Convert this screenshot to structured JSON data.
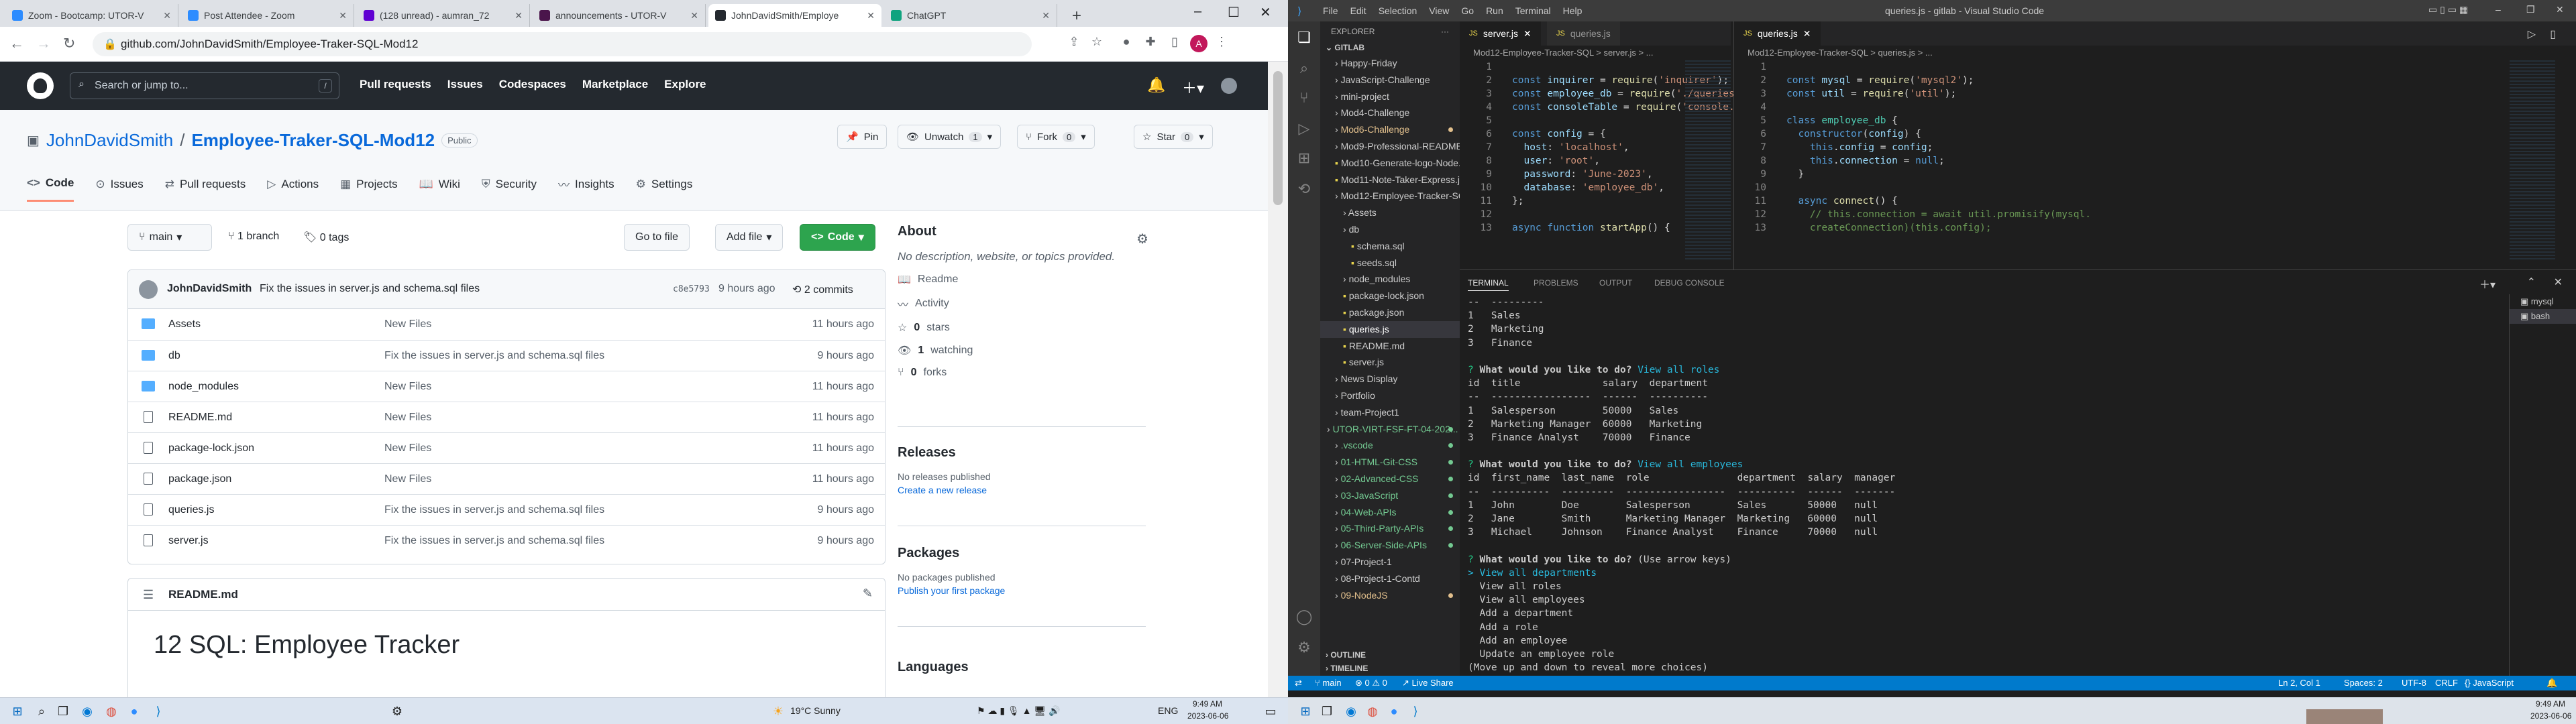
{
  "browser": {
    "tabs": [
      {
        "label": "Zoom - Bootcamp: UTOR-V",
        "color": "#2d8cff",
        "active": false
      },
      {
        "label": "Post Attendee - Zoom",
        "color": "#2d8cff",
        "active": false
      },
      {
        "label": "(128 unread) - aumran_72",
        "color": "#6001d2",
        "active": false
      },
      {
        "label": "announcements - UTOR-V",
        "color": "#4a154b",
        "active": false
      },
      {
        "label": "JohnDavidSmith/Employe",
        "color": "#24292f",
        "active": true
      },
      {
        "label": "ChatGPT",
        "color": "#10a37f",
        "active": false
      }
    ],
    "url": "github.com/JohnDavidSmith/Employee-Traker-SQL-Mod12"
  },
  "github": {
    "search_placeholder": "Search or jump to...",
    "search_key": "/",
    "nav": [
      "Pull requests",
      "Issues",
      "Codespaces",
      "Marketplace",
      "Explore"
    ],
    "owner": "JohnDavidSmith",
    "separator": "/",
    "repo": "Employee-Traker-SQL-Mod12",
    "visibility": "Public",
    "actions": {
      "pin": "Pin",
      "unwatch": "Unwatch",
      "watch_count": "1",
      "fork": "Fork",
      "fork_count": "0",
      "star": "Star",
      "star_count": "0"
    },
    "tabs": [
      "Code",
      "Issues",
      "Pull requests",
      "Actions",
      "Projects",
      "Wiki",
      "Security",
      "Insights",
      "Settings"
    ],
    "branch": "main",
    "branches": "1 branch",
    "tags": "0 tags",
    "buttons": {
      "goto": "Go to file",
      "add": "Add file",
      "code": "Code"
    },
    "commit": {
      "author": "JohnDavidSmith",
      "message": "Fix the issues in server.js and schema.sql files",
      "sha": "c8e5793",
      "ago": "9 hours ago",
      "count": "2 commits"
    },
    "files": [
      {
        "name": "Assets",
        "type": "folder",
        "msg": "New Files",
        "time": "11 hours ago"
      },
      {
        "name": "db",
        "type": "folder",
        "msg": "Fix the issues in server.js and schema.sql files",
        "time": "9 hours ago"
      },
      {
        "name": "node_modules",
        "type": "folder",
        "msg": "New Files",
        "time": "11 hours ago"
      },
      {
        "name": "README.md",
        "type": "file",
        "msg": "New Files",
        "time": "11 hours ago"
      },
      {
        "name": "package-lock.json",
        "type": "file",
        "msg": "New Files",
        "time": "11 hours ago"
      },
      {
        "name": "package.json",
        "type": "file",
        "msg": "New Files",
        "time": "11 hours ago"
      },
      {
        "name": "queries.js",
        "type": "file",
        "msg": "Fix the issues in server.js and schema.sql files",
        "time": "9 hours ago"
      },
      {
        "name": "server.js",
        "type": "file",
        "msg": "Fix the issues in server.js and schema.sql files",
        "time": "9 hours ago"
      }
    ],
    "readme_label": "README.md",
    "readme_title": "12 SQL: Employee Tracker",
    "about": {
      "title": "About",
      "desc": "No description, website, or topics provided.",
      "readme": "Readme",
      "activity": "Activity",
      "stars": "0",
      "stars_label": "stars",
      "watching": "1",
      "watching_label": "watching",
      "forks": "0",
      "forks_label": "forks"
    },
    "releases": {
      "title": "Releases",
      "none": "No releases published",
      "link": "Create a new release"
    },
    "packages": {
      "title": "Packages",
      "none": "No packages published",
      "link": "Publish your first package"
    },
    "languages": {
      "title": "Languages"
    }
  },
  "taskbar_left": {
    "weather": "19°C  Sunny",
    "lang": "ENG",
    "time": "9:49 AM",
    "date": "2023-06-06"
  },
  "vscode": {
    "menu": [
      "File",
      "Edit",
      "Selection",
      "View",
      "Go",
      "Run",
      "Terminal",
      "Help"
    ],
    "window_title": "queries.js - gitlab - Visual Studio Code",
    "explorer_title": "EXPLORER",
    "root": "GITLAB",
    "tree": [
      {
        "label": "Happy-Friday",
        "indent": 1,
        "color": "#cccccc",
        "dot": false
      },
      {
        "label": "JavaScript-Challenge",
        "indent": 1,
        "color": "#cccccc",
        "dot": false
      },
      {
        "label": "mini-project",
        "indent": 1,
        "color": "#cccccc",
        "dot": false
      },
      {
        "label": "Mod4-Challenge",
        "indent": 1,
        "color": "#cccccc",
        "dot": false
      },
      {
        "label": "Mod6-Challenge",
        "indent": 1,
        "color": "#e2c08d",
        "dot": true
      },
      {
        "label": "Mod9-Professional-README-Ge...",
        "indent": 1,
        "color": "#cccccc",
        "dot": false
      },
      {
        "label": "Mod10-Generate-logo-Node.js",
        "indent": 1,
        "color": "#cccccc",
        "dot": false
      },
      {
        "label": "Mod11-Note-Taker-Express.js",
        "indent": 1,
        "color": "#cccccc",
        "dot": false
      },
      {
        "label": "Mod12-Employee-Tracker-SQL",
        "indent": 1,
        "color": "#cccccc",
        "dot": false
      },
      {
        "label": "Assets",
        "indent": 2,
        "color": "#cccccc",
        "dot": false
      },
      {
        "label": "db",
        "indent": 2,
        "color": "#cccccc",
        "dot": false
      },
      {
        "label": "schema.sql",
        "indent": 3,
        "color": "#cccccc",
        "dot": false
      },
      {
        "label": "seeds.sql",
        "indent": 3,
        "color": "#cccccc",
        "dot": false
      },
      {
        "label": "node_modules",
        "indent": 2,
        "color": "#cccccc",
        "dot": false
      },
      {
        "label": "package-lock.json",
        "indent": 2,
        "color": "#cccccc",
        "dot": false
      },
      {
        "label": "package.json",
        "indent": 2,
        "color": "#cccccc",
        "dot": false
      },
      {
        "label": "queries.js",
        "indent": 2,
        "color": "#ffffff",
        "dot": false,
        "selected": true
      },
      {
        "label": "README.md",
        "indent": 2,
        "color": "#cccccc",
        "dot": false
      },
      {
        "label": "server.js",
        "indent": 2,
        "color": "#cccccc",
        "dot": false
      },
      {
        "label": "News Display",
        "indent": 1,
        "color": "#cccccc",
        "dot": false
      },
      {
        "label": "Portfolio",
        "indent": 1,
        "color": "#cccccc",
        "dot": false
      },
      {
        "label": "team-Project1",
        "indent": 1,
        "color": "#cccccc",
        "dot": false
      },
      {
        "label": "UTOR-VIRT-FSF-FT-04-202...",
        "indent": 0,
        "color": "#73c991",
        "dot": true
      },
      {
        "label": ".vscode",
        "indent": 1,
        "color": "#73c991",
        "dot": true
      },
      {
        "label": "01-HTML-Git-CSS",
        "indent": 1,
        "color": "#73c991",
        "dot": true
      },
      {
        "label": "02-Advanced-CSS",
        "indent": 1,
        "color": "#73c991",
        "dot": true
      },
      {
        "label": "03-JavaScript",
        "indent": 1,
        "color": "#73c991",
        "dot": true
      },
      {
        "label": "04-Web-APIs",
        "indent": 1,
        "color": "#73c991",
        "dot": true
      },
      {
        "label": "05-Third-Party-APIs",
        "indent": 1,
        "color": "#73c991",
        "dot": true
      },
      {
        "label": "06-Server-Side-APIs",
        "indent": 1,
        "color": "#73c991",
        "dot": true
      },
      {
        "label": "07-Project-1",
        "indent": 1,
        "color": "#cccccc",
        "dot": false
      },
      {
        "label": "08-Project-1-Contd",
        "indent": 1,
        "color": "#cccccc",
        "dot": false
      },
      {
        "label": "09-NodeJS",
        "indent": 1,
        "color": "#e2c08d",
        "dot": true
      }
    ],
    "outline": "OUTLINE",
    "timeline": "TIMELINE",
    "editor1": {
      "tabs": [
        "server.js",
        "queries.js"
      ],
      "crumbs": "Mod12-Employee-Tracker-SQL  >  server.js  >  ...",
      "lines": [
        {
          "n": "1",
          "html": ""
        },
        {
          "n": "2",
          "html": "<span class='kw'>const</span> <span class='var'>inquirer</span> = <span class='fn'>require</span>(<span class='str'>'inquirer'</span>);"
        },
        {
          "n": "3",
          "html": "<span class='kw'>const</span> <span class='var'>employee_db</span> = <span class='fn'>require</span>(<span class='str'>'./queries.js'</span>);"
        },
        {
          "n": "4",
          "html": "<span class='kw'>const</span> <span class='var'>consoleTable</span> = <span class='fn'>require</span>(<span class='str'>'console.table'</span>);"
        },
        {
          "n": "5",
          "html": ""
        },
        {
          "n": "6",
          "html": "<span class='kw'>const</span> <span class='var'>config</span> = {"
        },
        {
          "n": "7",
          "html": "  <span class='var'>host</span>: <span class='str'>'localhost'</span>,"
        },
        {
          "n": "8",
          "html": "  <span class='var'>user</span>: <span class='str'>'root'</span>,"
        },
        {
          "n": "9",
          "html": "  <span class='var'>password</span>: <span class='str'>'June-2023'</span>,"
        },
        {
          "n": "10",
          "html": "  <span class='var'>database</span>: <span class='str'>'employee_db'</span>,"
        },
        {
          "n": "11",
          "html": "};"
        },
        {
          "n": "12",
          "html": ""
        },
        {
          "n": "13",
          "html": "<span class='kw'>async</span> <span class='kw'>function</span> <span class='fn'>startApp</span>() {"
        }
      ]
    },
    "editor2": {
      "tabs": [
        "queries.js"
      ],
      "crumbs": "Mod12-Employee-Tracker-SQL  >  queries.js  >  ...",
      "lines": [
        {
          "n": "1",
          "html": ""
        },
        {
          "n": "2",
          "html": "<span class='kw'>const</span> <span class='var'>mysql</span> = <span class='fn'>require</span>(<span class='str'>'mysql2'</span>);"
        },
        {
          "n": "3",
          "html": "<span class='kw'>const</span> <span class='var'>util</span> = <span class='fn'>require</span>(<span class='str'>'util'</span>);"
        },
        {
          "n": "4",
          "html": ""
        },
        {
          "n": "5",
          "html": "<span class='kw'>class</span> <span class='cls'>employee_db</span> {"
        },
        {
          "n": "6",
          "html": "  <span class='kw'>constructor</span>(<span class='var'>config</span>) {"
        },
        {
          "n": "7",
          "html": "    <span class='kw'>this</span>.<span class='var'>config</span> = <span class='var'>config</span>;"
        },
        {
          "n": "8",
          "html": "    <span class='kw'>this</span>.<span class='var'>connection</span> = <span class='kw'>null</span>;"
        },
        {
          "n": "9",
          "html": "  }"
        },
        {
          "n": "10",
          "html": ""
        },
        {
          "n": "11",
          "html": "  <span class='kw'>async</span> <span class='fn'>connect</span>() {"
        },
        {
          "n": "12",
          "html": "    <span class='cmt'>// this.connection = await util.promisify(mysql.</span>"
        },
        {
          "n": "13",
          "html": "    <span class='cmt'>createConnection)(this.config);</span>"
        }
      ]
    },
    "panel_tabs": [
      "TERMINAL",
      "PROBLEMS",
      "OUTPUT",
      "DEBUG CONSOLE"
    ],
    "terminal_lines": [
      "--  ---------",
      "1   Sales",
      "2   Marketing",
      "3   Finance",
      "",
      "<span class='t-green'>?</span> <b>What would you like to do?</b> <span class='t-cyan'>View all roles</span>",
      "id  title              salary  department",
      "--  -----------------  ------  ----------",
      "1   Salesperson        50000   Sales",
      "2   Marketing Manager  60000   Marketing",
      "3   Finance Analyst    70000   Finance",
      "",
      "<span class='t-green'>?</span> <b>What would you like to do?</b> <span class='t-cyan'>View all employees</span>",
      "id  first_name  last_name  role               department  salary  manager",
      "--  ----------  ---------  -----------------  ----------  ------  -------",
      "1   John        Doe        Salesperson        Sales       50000   null",
      "2   Jane        Smith      Marketing Manager  Marketing   60000   null",
      "3   Michael     Johnson    Finance Analyst    Finance     70000   null",
      "",
      "<span class='t-green'>?</span> <b>What would you like to do?</b> (Use arrow keys)",
      "<span class='t-cyan'>&gt; View all departments</span>",
      "  View all roles",
      "  View all employees",
      "  Add a department",
      "  Add a role",
      "  Add an employee",
      "  Update an employee role",
      "(Move up and down to reveal more choices)"
    ],
    "terminals": [
      "mysql",
      "bash"
    ],
    "status": {
      "branch": "main",
      "errors": "0",
      "warnings": "0",
      "liveshare": "Live Share",
      "position": "Ln 2, Col 1",
      "spaces": "Spaces: 2",
      "encoding": "UTF-8",
      "eol": "CRLF",
      "language": "JavaScript"
    }
  },
  "taskbar_right": {
    "time": "9:49 AM",
    "date": "2023-06-06"
  }
}
